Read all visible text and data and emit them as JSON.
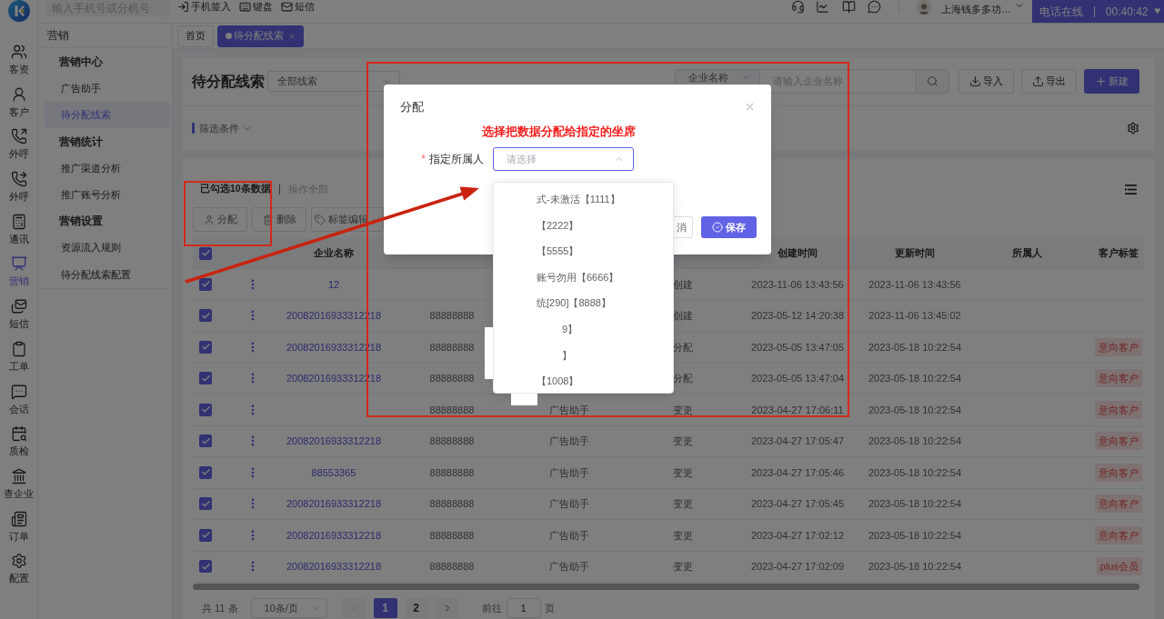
{
  "rail": {
    "items": [
      {
        "label": "客资",
        "selected": false
      },
      {
        "label": "客户",
        "selected": false
      },
      {
        "label": "外呼",
        "selected": false
      },
      {
        "label": "外呼",
        "selected": false
      },
      {
        "label": "通讯",
        "selected": false
      },
      {
        "label": "营销",
        "selected": true
      },
      {
        "label": "短信",
        "selected": false
      },
      {
        "label": "工单",
        "selected": false
      },
      {
        "label": "会话",
        "selected": false
      },
      {
        "label": "质检",
        "selected": false
      },
      {
        "label": "查企业",
        "selected": false
      },
      {
        "label": "订单",
        "selected": false
      },
      {
        "label": "配置",
        "selected": false
      }
    ]
  },
  "top_bar": {
    "search": {
      "placeholder": "输入手机号或分机号"
    },
    "actions": [
      {
        "label": "手机签入"
      },
      {
        "label": "键盘"
      },
      {
        "label": "短信"
      }
    ],
    "user": {
      "name": "上海钱多多功…"
    },
    "call_status": {
      "label": "电话在线",
      "timer": "00:40:42"
    }
  },
  "menu": {
    "title": "营销",
    "groups": [
      {
        "title": "营销中心",
        "items": [
          {
            "label": "广告助手",
            "selected": false
          },
          {
            "label": "待分配线索",
            "selected": true
          }
        ]
      },
      {
        "title": "营销统计",
        "items": [
          {
            "label": "推广渠道分析",
            "selected": false
          },
          {
            "label": "推广账号分析",
            "selected": false
          }
        ]
      },
      {
        "title": "营销设置",
        "items": [
          {
            "label": "资源流入规则",
            "selected": false
          },
          {
            "label": "待分配线索配置",
            "selected": false
          }
        ]
      }
    ]
  },
  "tabs": [
    {
      "label": "首页",
      "selected": false,
      "closable": false
    },
    {
      "label": "待分配线索",
      "selected": true,
      "closable": true
    }
  ],
  "page": {
    "title": "待分配线索",
    "scope_select": "全部线索",
    "search_by": "企业名称",
    "search_placeholder": "请输入企业名称",
    "buttons": [
      {
        "label": "导入",
        "kind": "import"
      },
      {
        "label": "导出",
        "kind": "export"
      },
      {
        "label": "新建",
        "kind": "create"
      }
    ],
    "filter": "筛选条件"
  },
  "selection": {
    "summary": "已勾选10条数据",
    "select_all": "操作全部"
  },
  "bulk_actions": [
    {
      "label": "分配",
      "kind": "assign"
    },
    {
      "label": "删除",
      "kind": "delete"
    },
    {
      "label": "标签编辑",
      "kind": "tags"
    }
  ],
  "table": {
    "header_checked": true,
    "columns": {
      "company": "企业名称",
      "created": "创建时间",
      "updated": "更新时间",
      "owner": "所属人",
      "tag": "客户标签"
    },
    "rows": [
      {
        "checked": true,
        "company": "12",
        "method": "创建",
        "created": "2023-11-06 13:43:56",
        "updated": "2023-11-06 13:43:56"
      },
      {
        "checked": true,
        "company": "20082016933312218",
        "phone": "88888888",
        "method": "创建",
        "created": "2023-05-12 14:20:38",
        "updated": "2023-11-06 13:45:02"
      },
      {
        "checked": true,
        "company": "20082016933312218",
        "phone": "88888888",
        "method": "分配",
        "created": "2023-05-05 13:47:05",
        "updated": "2023-05-18 10:22:54",
        "tag": "意向客户"
      },
      {
        "checked": true,
        "company": "20082016933312218",
        "phone": "88888888",
        "method": "分配",
        "created": "2023-05-05 13:47:04",
        "updated": "2023-05-18 10:22:54",
        "tag": "意向客户"
      },
      {
        "checked": true,
        "phone": "88888888",
        "source": "广告助手",
        "method": "变更",
        "created": "2023-04-27 17:06:11",
        "updated": "2023-05-18 10:22:54",
        "tag": "意向客户"
      },
      {
        "checked": true,
        "company": "20082016933312218",
        "phone": "88888888",
        "source": "广告助手",
        "method": "变更",
        "created": "2023-04-27 17:05:47",
        "updated": "2023-05-18 10:22:54",
        "tag": "意向客户"
      },
      {
        "checked": true,
        "company": "88553365",
        "phone": "88888888",
        "source": "广告助手",
        "method": "变更",
        "created": "2023-04-27 17:05:46",
        "updated": "2023-05-18 10:22:54",
        "tag": "意向客户"
      },
      {
        "checked": true,
        "company": "20082016933312218",
        "phone": "88888888",
        "source": "广告助手",
        "method": "变更",
        "created": "2023-04-27 17:05:45",
        "updated": "2023-05-18 10:22:54",
        "tag": "意向客户"
      },
      {
        "checked": true,
        "company": "20082016933312218",
        "phone": "88888888",
        "source": "广告助手",
        "method": "变更",
        "created": "2023-04-27 17:02:12",
        "updated": "2023-05-18 10:22:54",
        "tag": "意向客户"
      },
      {
        "checked": true,
        "company": "20082016933312218",
        "phone": "88888888",
        "source": "广告助手",
        "method": "变更",
        "created": "2023-04-27 17:02:09",
        "updated": "2023-05-18 10:22:54",
        "tag": "plus会员"
      }
    ]
  },
  "pagination": {
    "total": "共 11 条",
    "page_size": "10条/页",
    "prev_disabled": true,
    "pages": [
      {
        "label": "1",
        "selected": true
      },
      {
        "label": "2",
        "selected": false
      }
    ],
    "next_disabled": false,
    "goto_label": "前往",
    "goto_value": "1",
    "goto_suffix": "页"
  },
  "dialog": {
    "title": "分配",
    "notice": "选择把数据分配给指定的坐席",
    "field": {
      "required_mark": "*",
      "label": "指定所属人",
      "placeholder": "请选择",
      "open": true,
      "options": [
        {
          "label": "式-未激活【1111】",
          "partly_covered": false
        },
        {
          "label": "【2222】",
          "partly_covered": false
        },
        {
          "label": "【5555】",
          "partly_covered": false
        },
        {
          "label": "账号勿用【6666】",
          "partly_covered": false
        },
        {
          "label": "统[290]【8888】",
          "partly_covered": false
        },
        {
          "label": "9】",
          "partly_covered": true
        },
        {
          "label": "】",
          "partly_covered": true
        },
        {
          "label": "【1008】",
          "partly_covered": false
        }
      ]
    },
    "buttons": [
      {
        "label": "消",
        "kind": "cancel"
      },
      {
        "label": "保存",
        "kind": "primary"
      }
    ]
  }
}
